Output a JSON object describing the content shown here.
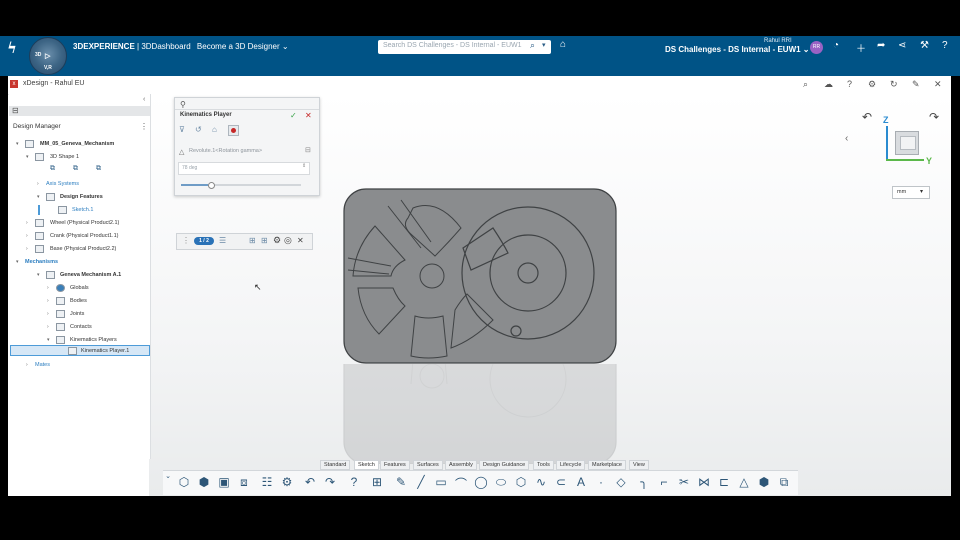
{
  "topbar": {
    "brand_bold": "3DEXPERIENCE",
    "brand_rest": " | 3DDashboard",
    "dashboard_name": "Become a 3D Designer",
    "search_placeholder": "Search DS Challenges - DS Internal - EUW1",
    "user_name": "Rahul RRI",
    "tenant": "DS Challenges - DS Internal - EUW1",
    "avatar_initials": "RR",
    "compass_labels": [
      "3D",
      "V,R"
    ]
  },
  "app": {
    "title": "xDesign - Rahul EU"
  },
  "tree": {
    "header": "Design Manager",
    "nodes": [
      {
        "label": "MM_05_Geneva_Mechanism",
        "bold": true
      },
      {
        "label": "3D Shape 1"
      },
      {
        "label": "Axis Systems",
        "blue": true
      },
      {
        "label": "Design Features",
        "bold": true
      },
      {
        "label": "Sketch.1",
        "blue": true
      },
      {
        "label": "Wheel (Physical Product2.1)"
      },
      {
        "label": "Crank (Physical Product1.1)"
      },
      {
        "label": "Base (Physical Product2.2)"
      },
      {
        "label": "Mechanisms",
        "blue": true,
        "bold": true
      },
      {
        "label": "Geneva Mechanism A.1",
        "bold": true
      },
      {
        "label": "Globals"
      },
      {
        "label": "Bodies"
      },
      {
        "label": "Joints"
      },
      {
        "label": "Contacts"
      },
      {
        "label": "Kinematics Players"
      },
      {
        "label": "Kinematics Player.1",
        "selected": true
      },
      {
        "label": "Mates",
        "blue": true
      }
    ]
  },
  "kinematics_panel": {
    "title": "Kinematics Player",
    "joint_label": "Revolute.1<Rotation gamma>",
    "value": "78 deg",
    "slider_level": 0.22
  },
  "player_bar": {
    "step_badge": "1 / 2"
  },
  "view": {
    "unit": "mm",
    "axis_z": "Z",
    "axis_y": "Y"
  },
  "bottom_tabs": [
    "Standard",
    "Sketch",
    "Features",
    "Surfaces",
    "Assembly",
    "Design Guidance",
    "Tools",
    "Lifecycle",
    "Marketplace",
    "View"
  ],
  "active_tab": "Sketch",
  "colors": {
    "topbar": "#005386",
    "model_fill": "#8a8c8e",
    "selection": "#d6e7f6",
    "accent_blue": "#2c7ec0"
  }
}
